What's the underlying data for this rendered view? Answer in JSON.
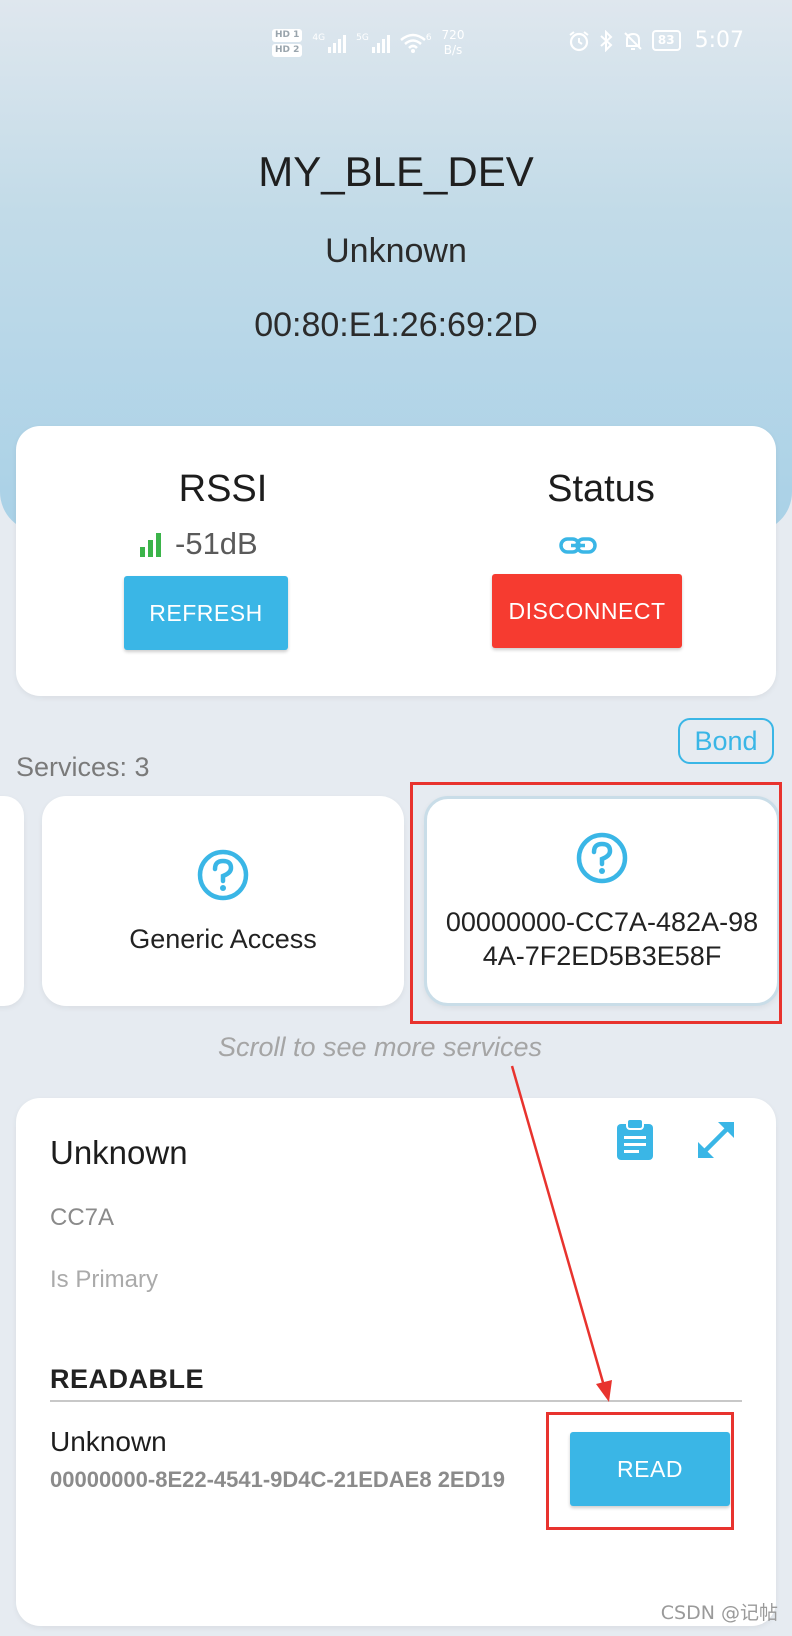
{
  "status_bar": {
    "hd_top": "HD 1",
    "hd_bottom": "HD 2",
    "sim1_tag": "4G",
    "sim2_tag": "5G",
    "wifi_tag": "6",
    "speed_value": "720",
    "speed_unit": "B/s",
    "battery": "83",
    "time": "5:07"
  },
  "device": {
    "name": "MY_BLE_DEV",
    "type": "Unknown",
    "mac": "00:80:E1:26:69:2D"
  },
  "info": {
    "rssi_title": "RSSI",
    "rssi_value": "-51dB",
    "refresh_label": "REFRESH",
    "status_title": "Status",
    "disconnect_label": "DISCONNECT"
  },
  "services": {
    "count_label": "Services: 3",
    "bond_label": "Bond",
    "items": [
      {
        "label": "Generic Access"
      },
      {
        "label": "00000000-CC7A-482A-98 4A-7F2ED5B3E58F"
      }
    ],
    "scroll_hint": "Scroll to see more services"
  },
  "detail": {
    "title": "Unknown",
    "short_uuid": "CC7A",
    "primary_label": "Is Primary",
    "section_title": "READABLE",
    "characteristic": {
      "name": "Unknown",
      "uuid": "00000000-8E22-4541-9D4C-21EDAE8 2ED19",
      "read_label": "READ"
    }
  },
  "watermark": "CSDN @记帖",
  "colors": {
    "accent_blue": "#3ab6e6",
    "danger_red": "#f63b30",
    "signal_green": "#3bb44a",
    "annotation_red": "#e8332e"
  }
}
